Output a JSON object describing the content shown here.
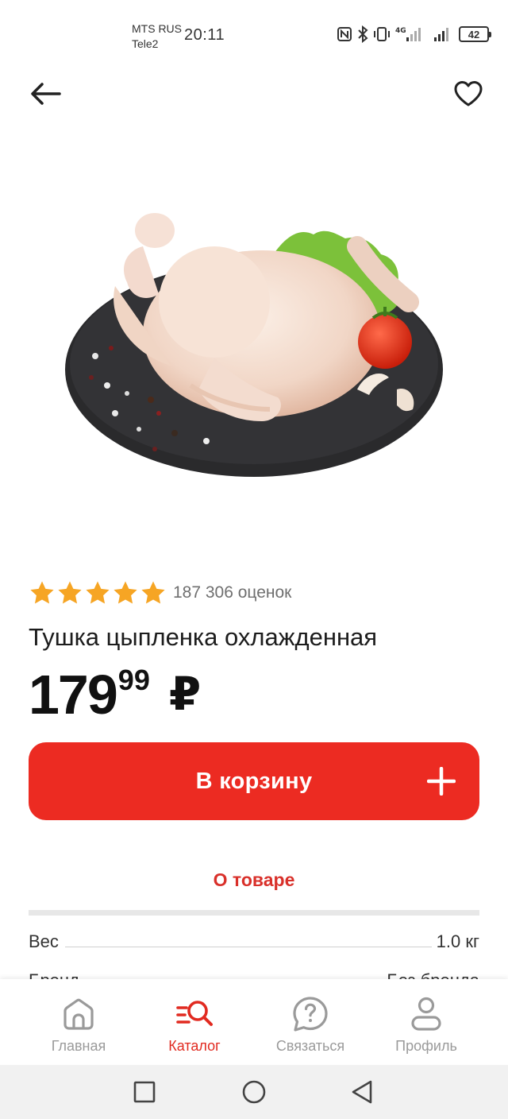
{
  "status_bar": {
    "carrier_1": "MTS RUS",
    "carrier_2": "Tele2",
    "time": "20:11",
    "network": "4G",
    "battery": "42"
  },
  "product": {
    "image_alt": "raw chicken on slate plate",
    "rating_stars": 5,
    "rating_count": "187 306 оценок",
    "title": "Тушка цыпленка охлажденная",
    "price_int": "179",
    "price_frac": "99",
    "currency": "₽",
    "cart_label": "В корзину"
  },
  "details": {
    "tab_label": "О товаре",
    "specs": [
      {
        "name": "Вес",
        "value": "1.0 кг"
      },
      {
        "name": "Бренд",
        "value": "Без бренда"
      }
    ]
  },
  "bottom_nav": [
    {
      "label": "Главная",
      "icon": "home-icon"
    },
    {
      "label": "Каталог",
      "icon": "catalog-search-icon"
    },
    {
      "label": "Связаться",
      "icon": "question-bubble-icon"
    },
    {
      "label": "Профиль",
      "icon": "profile-icon"
    }
  ],
  "colors": {
    "accent": "#ec2b22",
    "star": "#f6a524",
    "active_nav": "#e12a20",
    "inactive_nav": "#9a9a9a"
  }
}
